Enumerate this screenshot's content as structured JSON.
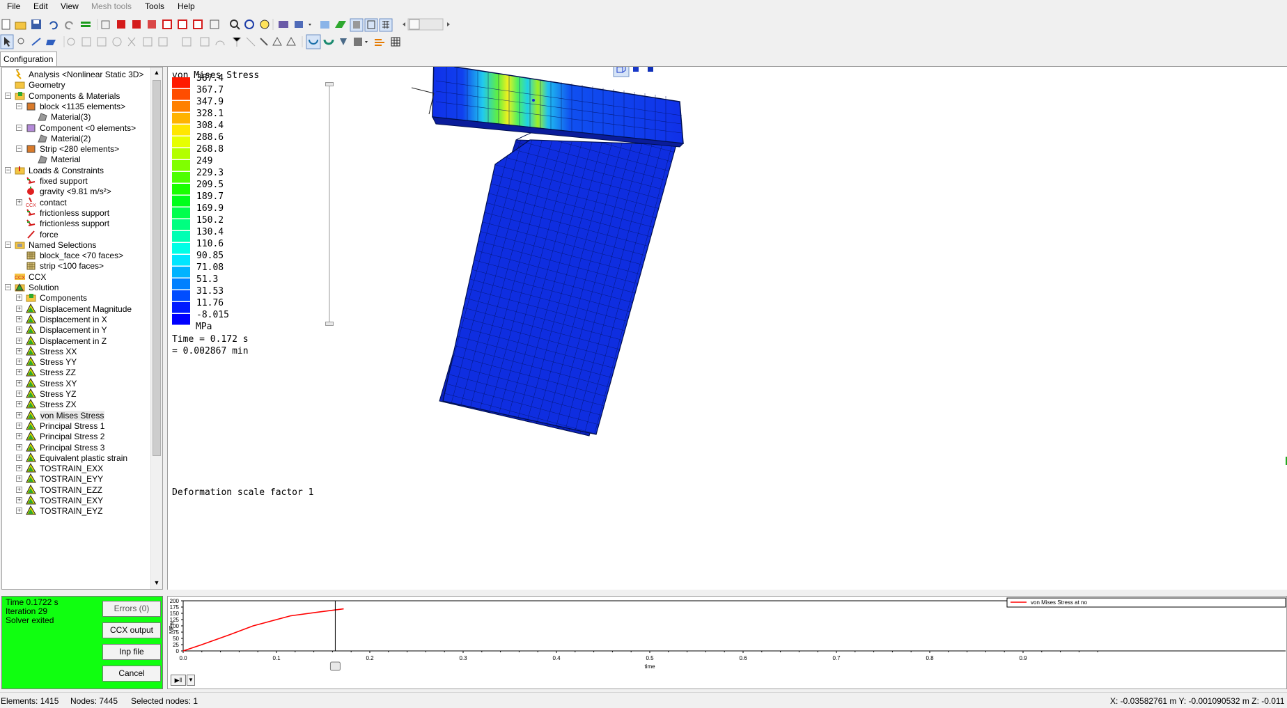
{
  "menu": {
    "file": "File",
    "edit": "Edit",
    "view": "View",
    "mesh_tools": "Mesh tools",
    "tools": "Tools",
    "help": "Help"
  },
  "tab": {
    "configuration": "Configuration"
  },
  "tree": {
    "analysis": "Analysis <Nonlinear Static 3D>",
    "geometry": "Geometry",
    "components_materials": "Components & Materials",
    "block": "block <1135 elements>",
    "material3": "Material(3)",
    "component": "Component <0 elements>",
    "material2": "Material(2)",
    "strip": "Strip <280 elements>",
    "material": "Material",
    "loads_constraints": "Loads & Constraints",
    "fixed_support": "fixed support",
    "gravity": "gravity <9.81 m/s²>",
    "contact": "contact",
    "frictionless_support_1": "frictionless support",
    "frictionless_support_2": "frictionless support",
    "force": "force",
    "named_selections": "Named Selections",
    "block_face": "block_face <70 faces>",
    "strip_faces": "strip <100 faces>",
    "ccx": "CCX",
    "solution": "Solution",
    "results": [
      "Components",
      "Displacement Magnitude",
      "Displacement in X",
      "Displacement in Y",
      "Displacement in Z",
      "Stress XX",
      "Stress YY",
      "Stress ZZ",
      "Stress XY",
      "Stress YZ",
      "Stress ZX",
      "von Mises Stress",
      "Principal Stress 1",
      "Principal Stress 2",
      "Principal Stress 3",
      "Equivalent plastic strain",
      "TOSTRAIN_EXX",
      "TOSTRAIN_EYY",
      "TOSTRAIN_EZZ",
      "TOSTRAIN_EXY",
      "TOSTRAIN_EYZ"
    ],
    "selected_result": "von Mises Stress"
  },
  "legend": {
    "title": "von Mises Stress",
    "values": [
      "387.4",
      "367.7",
      "347.9",
      "328.1",
      "308.4",
      "288.6",
      "268.8",
      "249",
      "229.3",
      "209.5",
      "189.7",
      "169.9",
      "150.2",
      "130.4",
      "110.6",
      "90.85",
      "71.08",
      "51.3",
      "31.53",
      "11.76",
      "-8.015"
    ],
    "colors": [
      "#ff1a00",
      "#ff4d00",
      "#ff8000",
      "#ffb300",
      "#ffe600",
      "#e6ff00",
      "#b3ff00",
      "#80ff00",
      "#4dff00",
      "#1aff00",
      "#00ff1a",
      "#00ff4d",
      "#00ff80",
      "#00ffb3",
      "#00ffe6",
      "#00e6ff",
      "#00b3ff",
      "#0080ff",
      "#004dff",
      "#001aff",
      "#0000ff"
    ],
    "unit": "MPa",
    "time_line1": "Time = 0.172 s",
    "time_line2": "= 0.002867 min",
    "deformation": "Deformation scale factor 1"
  },
  "solver": {
    "time": "Time 0.1722 s",
    "iteration": "Iteration 29",
    "status": "Solver exited",
    "errors_button": "Errors (0)",
    "ccx_output_button": "CCX output",
    "inp_file_button": "Inp file",
    "cancel_button": "Cancel",
    "status_color": "#10ff10"
  },
  "chart_data": {
    "type": "line",
    "ylabel": "MPa",
    "xlabel": "time",
    "ylim": [
      0,
      200
    ],
    "xlim": [
      0,
      1
    ],
    "x_ticks": [
      "0.0",
      "0.1",
      "0.2",
      "0.3",
      "0.4",
      "0.5",
      "0.6",
      "0.7",
      "0.8",
      "0.9"
    ],
    "y_ticks": [
      "0",
      "25",
      "50",
      "75",
      "100",
      "125",
      "150",
      "175",
      "200"
    ],
    "series": [
      {
        "name": "von Mises Stress at no",
        "color": "#ff0000",
        "x": [
          0.0,
          0.02,
          0.05,
          0.075,
          0.115,
          0.145,
          0.172
        ],
        "y": [
          0,
          25,
          65,
          100,
          140,
          155,
          168
        ]
      }
    ],
    "cursor_x": 0.163
  },
  "status": {
    "elements": "Elements: 1415",
    "nodes": "Nodes: 7445",
    "selected": "Selected nodes: 1",
    "coords": "X: -0.03582761 m Y: -0.001090532 m Z: -0.011"
  }
}
